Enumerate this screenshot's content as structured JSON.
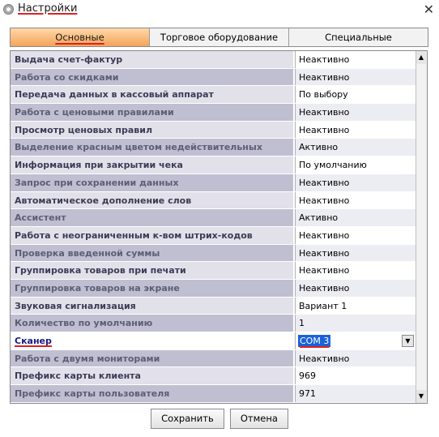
{
  "window": {
    "title": "Настройки",
    "close_glyph": "✕",
    "icon": "gear-icon"
  },
  "tabs": [
    {
      "label": "Основные",
      "active": true
    },
    {
      "label": "Торговое оборудование",
      "active": false
    },
    {
      "label": "Специальные",
      "active": false
    }
  ],
  "settings": [
    {
      "name": "Выдача счет-фактур",
      "value": "Неактивно"
    },
    {
      "name": "Работа со скидками",
      "value": "Неактивно"
    },
    {
      "name": "Передача данных в кассовый аппарат",
      "value": "По выбору"
    },
    {
      "name": "Работа с ценовыми правилами",
      "value": "Неактивно"
    },
    {
      "name": "Просмотр ценовых правил",
      "value": "Неактивно"
    },
    {
      "name": "Выделение красным цветом недействительных",
      "value": "Активно"
    },
    {
      "name": "Информация при закрытии чека",
      "value": "По умолчанию"
    },
    {
      "name": "Запрос при сохранении данных",
      "value": "Неактивно"
    },
    {
      "name": "Автоматическое дополнение слов",
      "value": "Неактивно"
    },
    {
      "name": "Ассистент",
      "value": "Активно"
    },
    {
      "name": "Работа с неограниченным к-вом штрих-кодов",
      "value": "Неактивно"
    },
    {
      "name": "Проверка введенной суммы",
      "value": "Неактивно"
    },
    {
      "name": "Группировка товаров при печати",
      "value": "Неактивно"
    },
    {
      "name": "Группировка товаров на экране",
      "value": "Неактивно"
    },
    {
      "name": "Звуковая сигнализация",
      "value": "Вариант 1"
    },
    {
      "name": "Количество по умолчанию",
      "value": "1"
    },
    {
      "name": "Сканер",
      "value": "COM 3",
      "selected": true
    },
    {
      "name": "Работа с двумя мониторами",
      "value": "Неактивно"
    },
    {
      "name": "Префикс карты клиента",
      "value": "969"
    },
    {
      "name": "Префикс карты пользователя",
      "value": "971"
    }
  ],
  "scrollbar": {
    "up_glyph": "▲",
    "down_glyph": "▼",
    "combo_glyph": "▼"
  },
  "footer": {
    "save_label": "Сохранить",
    "cancel_label": "Отмена"
  },
  "colors": {
    "active_tab": "#f4a35a",
    "row_odd_name": "#e2e1ea",
    "row_even_name": "#c0bfd1",
    "selection": "#1a62d9",
    "highlight_underline": "#e02020"
  }
}
